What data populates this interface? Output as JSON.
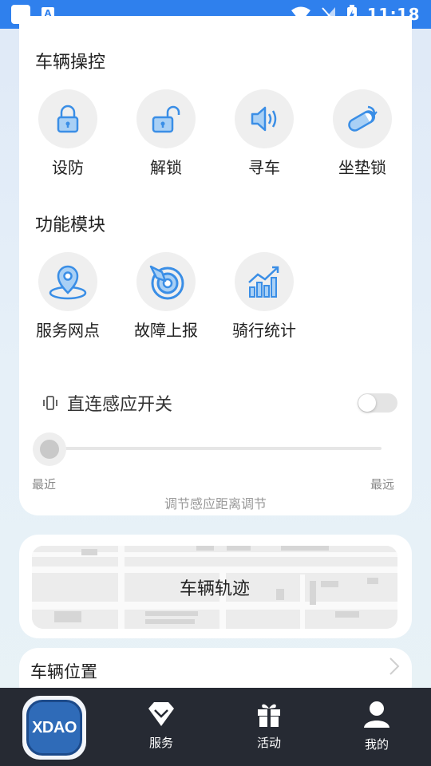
{
  "status_bar": {
    "time": "11:18"
  },
  "vehicle_control": {
    "title": "车辆操控",
    "items": [
      {
        "label": "设防",
        "icon": "lock-icon"
      },
      {
        "label": "解锁",
        "icon": "unlock-icon"
      },
      {
        "label": "寻车",
        "icon": "speaker-icon"
      },
      {
        "label": "坐垫锁",
        "icon": "seat-lock-icon"
      }
    ]
  },
  "function_modules": {
    "title": "功能模块",
    "items": [
      {
        "label": "服务网点",
        "icon": "location-pin-icon"
      },
      {
        "label": "故障上报",
        "icon": "target-icon"
      },
      {
        "label": "骑行统计",
        "icon": "stats-chart-icon"
      }
    ]
  },
  "proximity": {
    "label": "直连感应开关",
    "enabled": false,
    "min_label": "最近",
    "max_label": "最远",
    "caption": "调节感应距离调节",
    "slider_value": 0
  },
  "track": {
    "title": "车辆轨迹"
  },
  "location": {
    "title": "车辆位置"
  },
  "bottom_nav": {
    "logo_text": "XDAO",
    "items": [
      {
        "label": "服务",
        "icon": "diamond-icon"
      },
      {
        "label": "活动",
        "icon": "gift-icon"
      },
      {
        "label": "我的",
        "icon": "user-icon"
      }
    ]
  },
  "colors": {
    "accent": "#2f80ed",
    "nav_bg": "#262a33",
    "icon_blue": "#3a8ee6"
  }
}
